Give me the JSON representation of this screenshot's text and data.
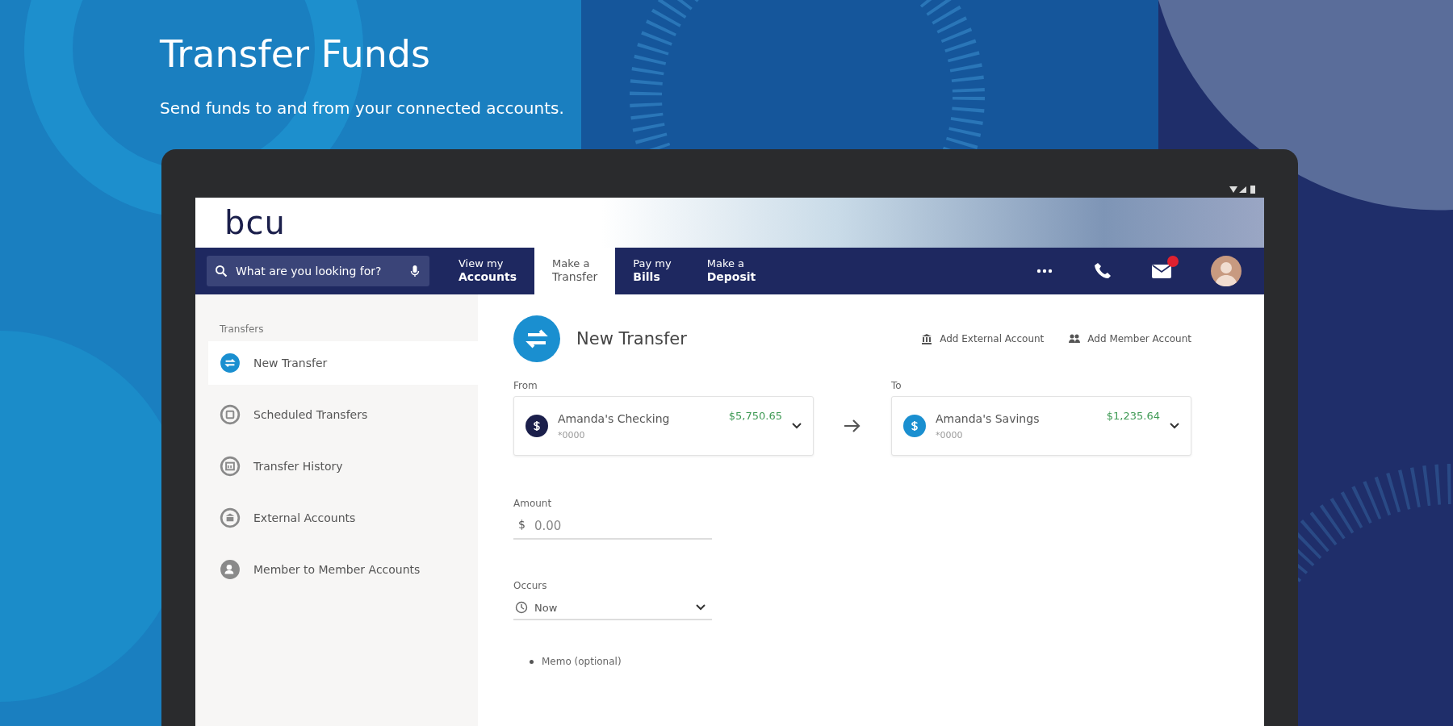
{
  "hero": {
    "title": "Transfer Funds",
    "subtitle": "Send funds to and from your connected accounts."
  },
  "app": {
    "logo": "bcu",
    "search": {
      "placeholder": "What are you looking for?"
    },
    "nav_tabs": [
      {
        "line1": "View my",
        "line2": "Accounts",
        "selected": false
      },
      {
        "line1": "Make a",
        "line2": "Transfer",
        "selected": true
      },
      {
        "line1": "Pay my",
        "line2": "Bills",
        "selected": false
      },
      {
        "line1": "Make a",
        "line2": "Deposit",
        "selected": false
      }
    ],
    "sidebar": {
      "heading": "Transfers",
      "items": [
        {
          "label": "New Transfer",
          "kind": "transfer",
          "selected": true
        },
        {
          "label": "Scheduled Transfers",
          "kind": "scheduled",
          "selected": false
        },
        {
          "label": "Transfer History",
          "kind": "history",
          "selected": false
        },
        {
          "label": "External Accounts",
          "kind": "external",
          "selected": false
        },
        {
          "label": "Member to Member Accounts",
          "kind": "member",
          "selected": false
        }
      ]
    },
    "page": {
      "title": "New Transfer",
      "actions": [
        {
          "label": "Add External Account",
          "kind": "external"
        },
        {
          "label": "Add Member Account",
          "kind": "member"
        }
      ],
      "accounts": [
        {
          "label": "From",
          "name": "Amanda's Checking",
          "number": "*0000",
          "balance": "$5,750.65",
          "color": "#1b1f4b"
        },
        {
          "label": "To",
          "name": "Amanda's Savings",
          "number": "*0000",
          "balance": "$1,235.64",
          "color": "#1a8fd0"
        }
      ],
      "amount": {
        "label": "Amount",
        "currency": "$",
        "placeholder": "0.00"
      },
      "occurs": {
        "label": "Occurs",
        "value": "Now"
      },
      "memo": {
        "label": "Memo (optional)"
      }
    }
  }
}
